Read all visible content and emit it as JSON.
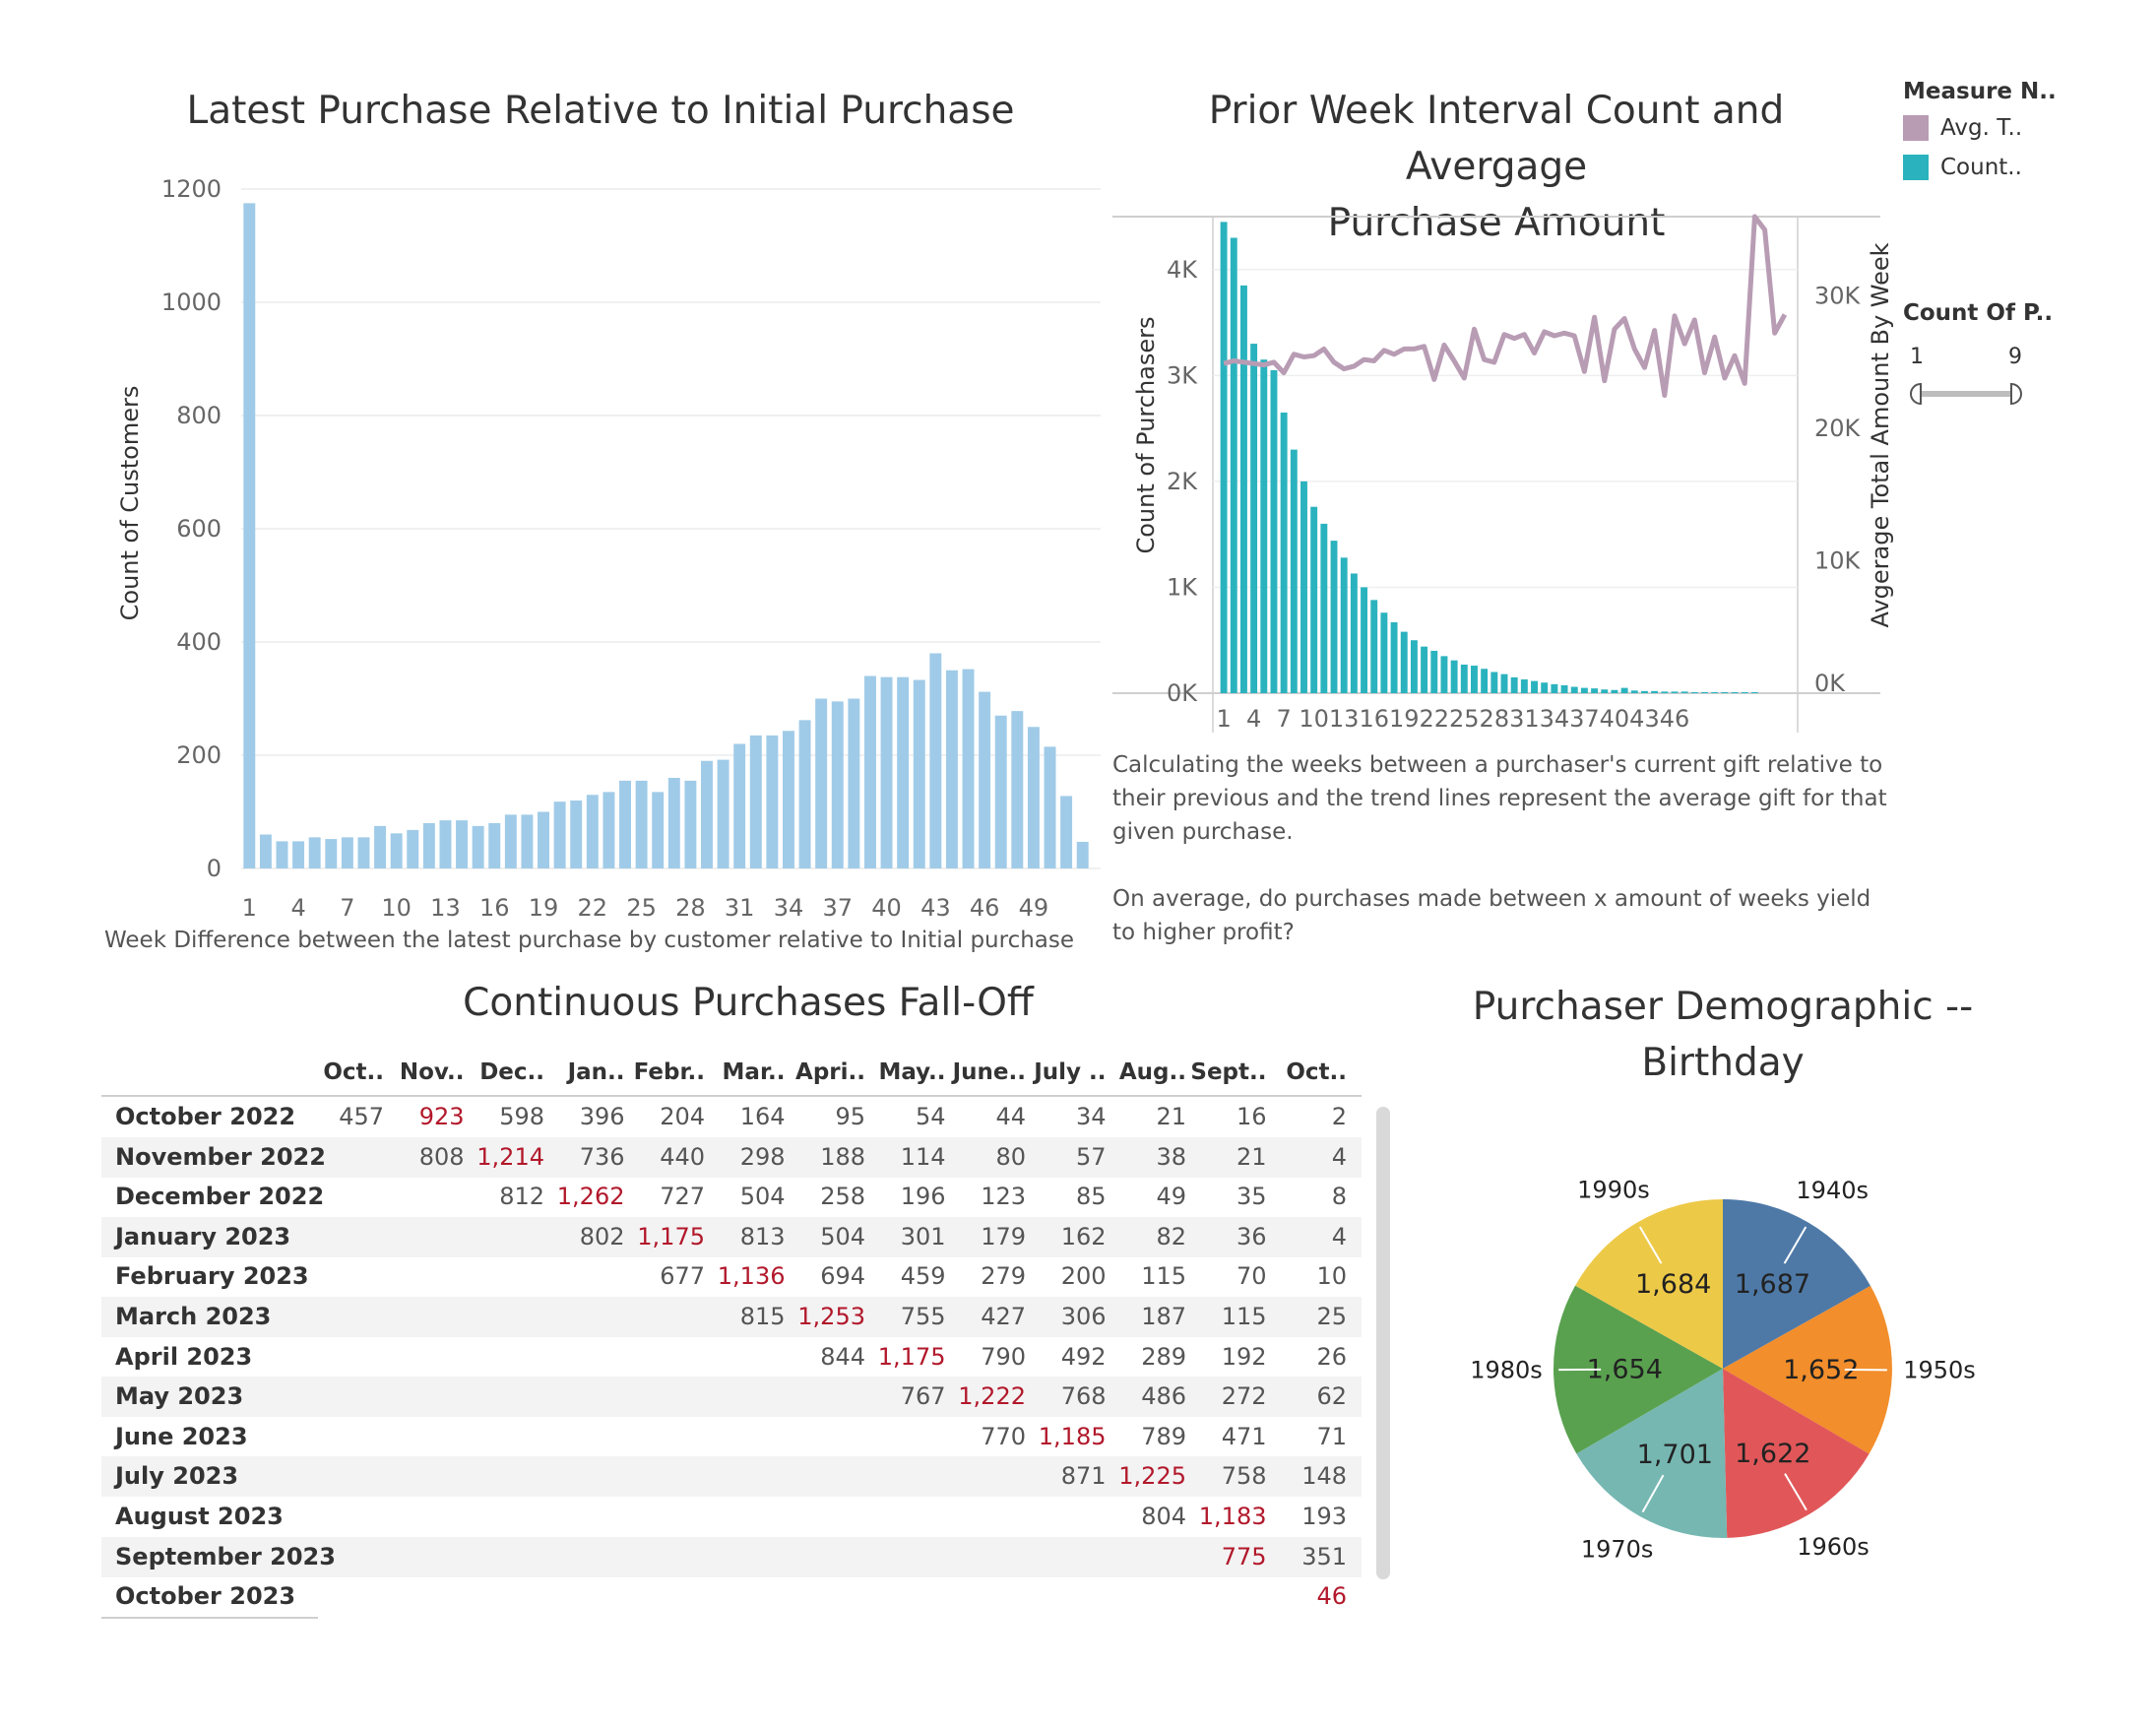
{
  "chart_data": [
    {
      "type": "bar",
      "title": "Latest Purchase Relative to Initial Purchase",
      "xlabel": "Week Difference between the latest purchase by customer relative to Initial purchase",
      "ylabel": "Count of Customers",
      "x": [
        1,
        2,
        3,
        4,
        5,
        6,
        7,
        8,
        9,
        10,
        11,
        12,
        13,
        14,
        15,
        16,
        17,
        18,
        19,
        20,
        21,
        22,
        23,
        24,
        25,
        26,
        27,
        28,
        29,
        30,
        31,
        32,
        33,
        34,
        35,
        36,
        37,
        38,
        39,
        40,
        41,
        42,
        43,
        44,
        45,
        46,
        47,
        48,
        49,
        50,
        51
      ],
      "values": [
        1175,
        60,
        48,
        48,
        55,
        52,
        55,
        55,
        75,
        62,
        68,
        80,
        85,
        85,
        75,
        80,
        95,
        95,
        100,
        118,
        120,
        130,
        135,
        155,
        155,
        135,
        160,
        155,
        190,
        192,
        220,
        235,
        235,
        243,
        262,
        300,
        295,
        300,
        340,
        338,
        338,
        333,
        380,
        350,
        352,
        312,
        270,
        278,
        250,
        215,
        128,
        47
      ],
      "xticks": [
        "1",
        "4",
        "7",
        "10",
        "13",
        "16",
        "19",
        "22",
        "25",
        "28",
        "31",
        "34",
        "37",
        "40",
        "43",
        "46",
        "49"
      ],
      "yticks": [
        "0",
        "200",
        "400",
        "600",
        "800",
        "1000",
        "1200"
      ],
      "ylim": [
        0,
        1200
      ],
      "color": "#a0cbe8"
    },
    {
      "type": "bar+line",
      "title_line1": "Prior Week Interval Count and Avergage",
      "title_line2": "Purchase Amount",
      "ylabel_left": "Count of Purchasers",
      "ylabel_right": "Avgerage Total Amount By Week",
      "xticks": [
        "1",
        "4",
        "7",
        "10",
        "13",
        "16",
        "19",
        "22",
        "25",
        "28",
        "31",
        "34",
        "37",
        "40",
        "43",
        "46"
      ],
      "yticks_left": [
        "0K",
        "1K",
        "2K",
        "3K",
        "4K"
      ],
      "yticks_right": [
        "0K",
        "10K",
        "20K",
        "30K"
      ],
      "ylim_left": [
        0,
        4500
      ],
      "ylim_right": [
        0,
        36000
      ],
      "series": [
        {
          "name": "Count..",
          "color": "#2ab3be",
          "values": [
            4450,
            4300,
            3850,
            3300,
            3150,
            3050,
            2650,
            2300,
            2000,
            1760,
            1600,
            1440,
            1280,
            1130,
            1000,
            880,
            760,
            670,
            580,
            500,
            440,
            400,
            350,
            310,
            270,
            260,
            230,
            200,
            180,
            150,
            130,
            115,
            100,
            85,
            75,
            60,
            50,
            45,
            35,
            30,
            50,
            25,
            20,
            20,
            15,
            15,
            15,
            10,
            10,
            10,
            10,
            10,
            10,
            10
          ]
        },
        {
          "name": "Avg. T..",
          "color": "#b89cb4",
          "values": [
            24900,
            25100,
            25000,
            24900,
            24800,
            25000,
            24200,
            25600,
            25400,
            25500,
            26000,
            25000,
            24500,
            24700,
            25200,
            25100,
            25900,
            25600,
            26000,
            26000,
            26200,
            23700,
            26300,
            25100,
            23800,
            27500,
            25200,
            25000,
            27100,
            26800,
            27100,
            25700,
            27300,
            27000,
            27200,
            27000,
            24300,
            28400,
            23600,
            27500,
            28300,
            26000,
            24600,
            27400,
            22500,
            28500,
            26400,
            28200,
            24200,
            26900,
            23800,
            25500,
            23400,
            36000,
            35000,
            27200,
            28600
          ]
        }
      ],
      "legend_title": "Measure N..",
      "slider_title": "Count Of P..",
      "slider_min": "1",
      "slider_max": "9"
    },
    {
      "type": "pie",
      "title_line1": "Purchaser Demographic --",
      "title_line2": "Birthday",
      "slices": [
        {
          "label": "1940s",
          "value": 1687,
          "color": "#4e79a7"
        },
        {
          "label": "1950s",
          "value": 1652,
          "color": "#f28e2b"
        },
        {
          "label": "1960s",
          "value": 1622,
          "color": "#e15759"
        },
        {
          "label": "1970s",
          "value": 1701,
          "color": "#76b7b2"
        },
        {
          "label": "1980s",
          "value": 1654,
          "color": "#59a14f"
        },
        {
          "label": "1990s",
          "value": 1684,
          "color": "#edc948"
        }
      ]
    }
  ],
  "notes": {
    "p1": "Calculating the weeks between a purchaser's current gift relative to their previous and the trend lines represent the average gift for that given purchase.",
    "p2": "On average, do purchases made between x amount of weeks yield to higher profit?"
  },
  "table": {
    "title": "Continuous Purchases Fall-Off",
    "columns": [
      "Oct..",
      "Nov..",
      "Dec..",
      "Jan..",
      "Febr..",
      "Mar..",
      "Apri..",
      "May..",
      "June..",
      "July ..",
      "Aug..",
      "Sept..",
      "Oct.."
    ],
    "rows": [
      {
        "label": "October 2022",
        "start": 0,
        "cells": [
          "457",
          "923",
          "598",
          "396",
          "204",
          "164",
          "95",
          "54",
          "44",
          "34",
          "21",
          "16",
          "2"
        ]
      },
      {
        "label": "November 2022",
        "start": 1,
        "cells": [
          "808",
          "1,214",
          "736",
          "440",
          "298",
          "188",
          "114",
          "80",
          "57",
          "38",
          "21",
          "4"
        ]
      },
      {
        "label": "December 2022",
        "start": 2,
        "cells": [
          "812",
          "1,262",
          "727",
          "504",
          "258",
          "196",
          "123",
          "85",
          "49",
          "35",
          "8"
        ]
      },
      {
        "label": "January 2023",
        "start": 3,
        "cells": [
          "802",
          "1,175",
          "813",
          "504",
          "301",
          "179",
          "162",
          "82",
          "36",
          "4"
        ]
      },
      {
        "label": "February 2023",
        "start": 4,
        "cells": [
          "677",
          "1,136",
          "694",
          "459",
          "279",
          "200",
          "115",
          "70",
          "10"
        ]
      },
      {
        "label": "March 2023",
        "start": 5,
        "cells": [
          "815",
          "1,253",
          "755",
          "427",
          "306",
          "187",
          "115",
          "25"
        ]
      },
      {
        "label": "April 2023",
        "start": 6,
        "cells": [
          "844",
          "1,175",
          "790",
          "492",
          "289",
          "192",
          "26"
        ]
      },
      {
        "label": "May 2023",
        "start": 7,
        "cells": [
          "767",
          "1,222",
          "768",
          "486",
          "272",
          "62"
        ]
      },
      {
        "label": "June 2023",
        "start": 8,
        "cells": [
          "770",
          "1,185",
          "789",
          "471",
          "71"
        ]
      },
      {
        "label": "July 2023",
        "start": 9,
        "cells": [
          "871",
          "1,225",
          "758",
          "148"
        ]
      },
      {
        "label": "August 2023",
        "start": 10,
        "cells": [
          "804",
          "1,183",
          "193"
        ]
      },
      {
        "label": "September 2023",
        "start": 11,
        "cells": [
          "775",
          "351"
        ]
      },
      {
        "label": "October 2023",
        "start": 12,
        "cells": [
          "46"
        ]
      }
    ],
    "highlight_color": "#b2182b"
  }
}
